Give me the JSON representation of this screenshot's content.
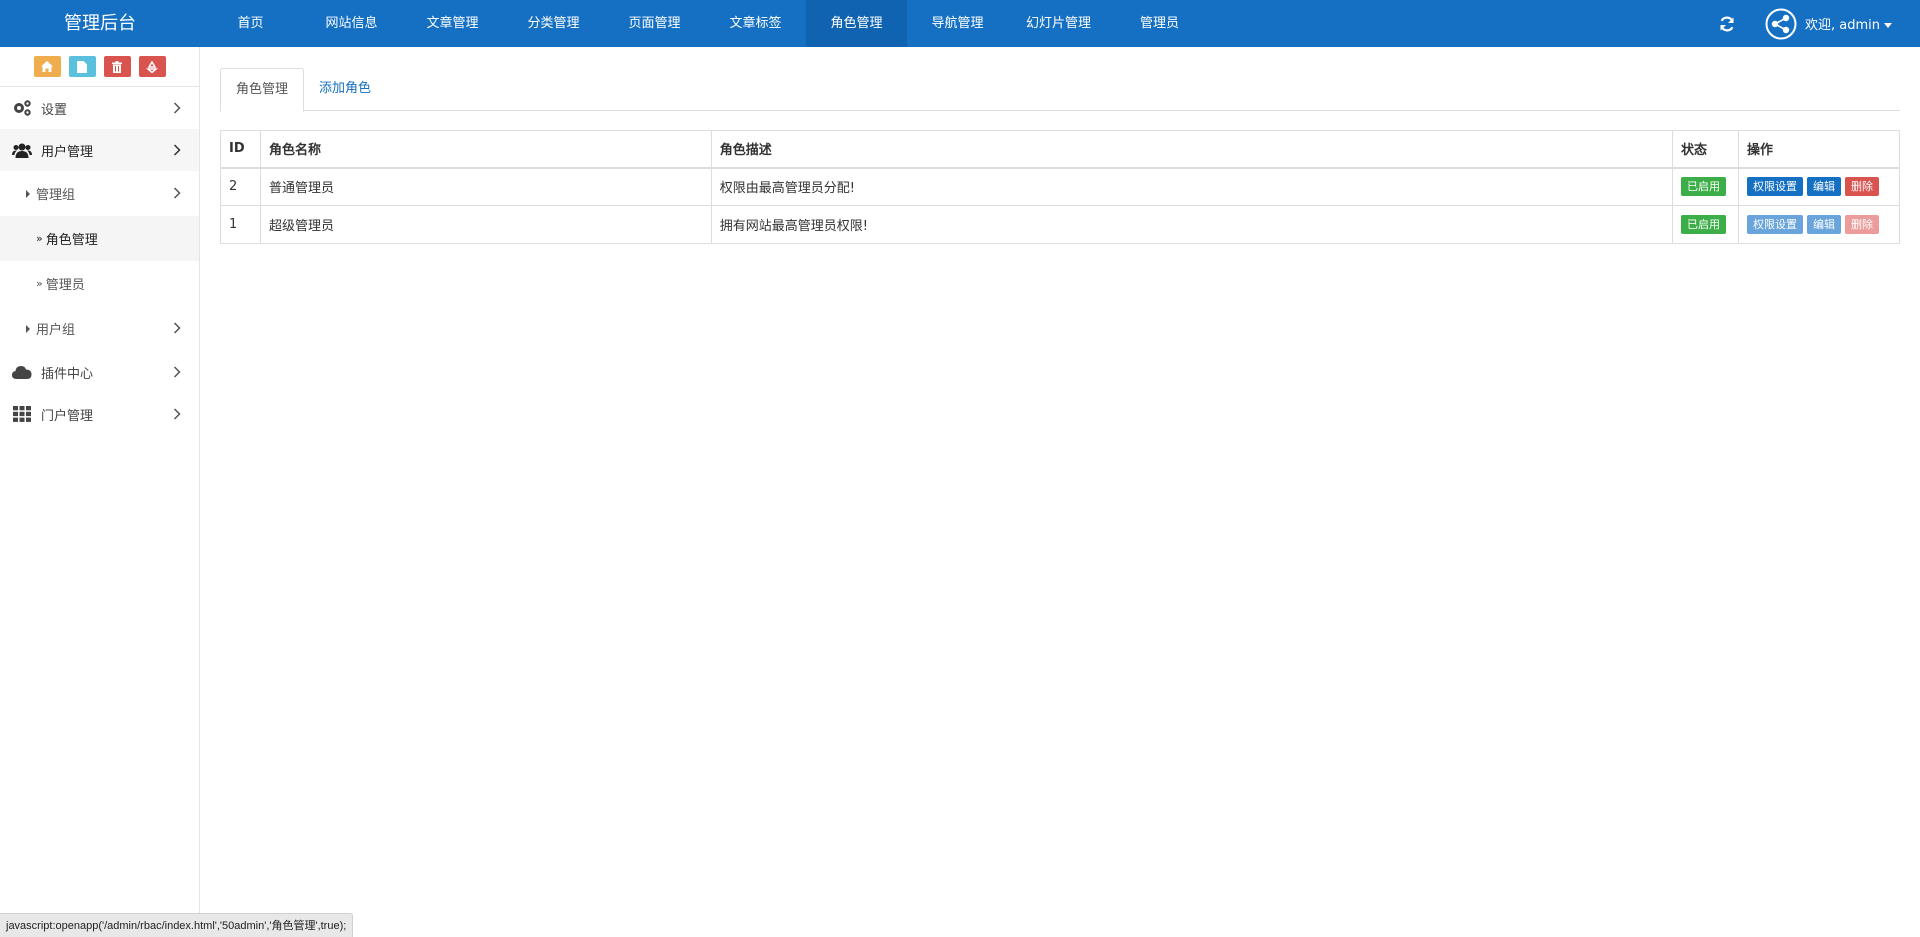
{
  "brand": "管理后台",
  "topnav": [
    {
      "label": "首页",
      "active": false
    },
    {
      "label": "网站信息",
      "active": false
    },
    {
      "label": "文章管理",
      "active": false
    },
    {
      "label": "分类管理",
      "active": false
    },
    {
      "label": "页面管理",
      "active": false
    },
    {
      "label": "文章标签",
      "active": false
    },
    {
      "label": "角色管理",
      "active": true
    },
    {
      "label": "导航管理",
      "active": false
    },
    {
      "label": "幻灯片管理",
      "active": false
    },
    {
      "label": "管理员",
      "active": false
    }
  ],
  "user": {
    "welcome": "欢迎, admin"
  },
  "sidebar": {
    "menu": [
      {
        "label": "设置"
      },
      {
        "label": "用户管理"
      },
      {
        "label": "管理组"
      },
      {
        "label": "角色管理"
      },
      {
        "label": "管理员"
      },
      {
        "label": "用户组"
      },
      {
        "label": "插件中心"
      },
      {
        "label": "门户管理"
      }
    ]
  },
  "tabs": {
    "active": "角色管理",
    "add": "添加角色"
  },
  "table": {
    "headers": [
      "ID",
      "角色名称",
      "角色描述",
      "状态",
      "操作"
    ],
    "rows": [
      {
        "id": "2",
        "name": "普通管理员",
        "desc": "权限由最高管理员分配!",
        "status": "已启用",
        "ops": [
          "权限设置",
          "编辑",
          "删除"
        ]
      },
      {
        "id": "1",
        "name": "超级管理员",
        "desc": "拥有网站最高管理员权限!",
        "status": "已启用",
        "ops": [
          "权限设置",
          "编辑",
          "删除"
        ]
      }
    ]
  },
  "statusbar": "javascript:openapp('/admin/rbac/index.html','50admin','角色管理',true);",
  "colors": {
    "primary": "#1570c4",
    "success": "#3cae48",
    "danger": "#d9534f",
    "warning": "#f0ad4e",
    "info": "#5bc0de"
  }
}
